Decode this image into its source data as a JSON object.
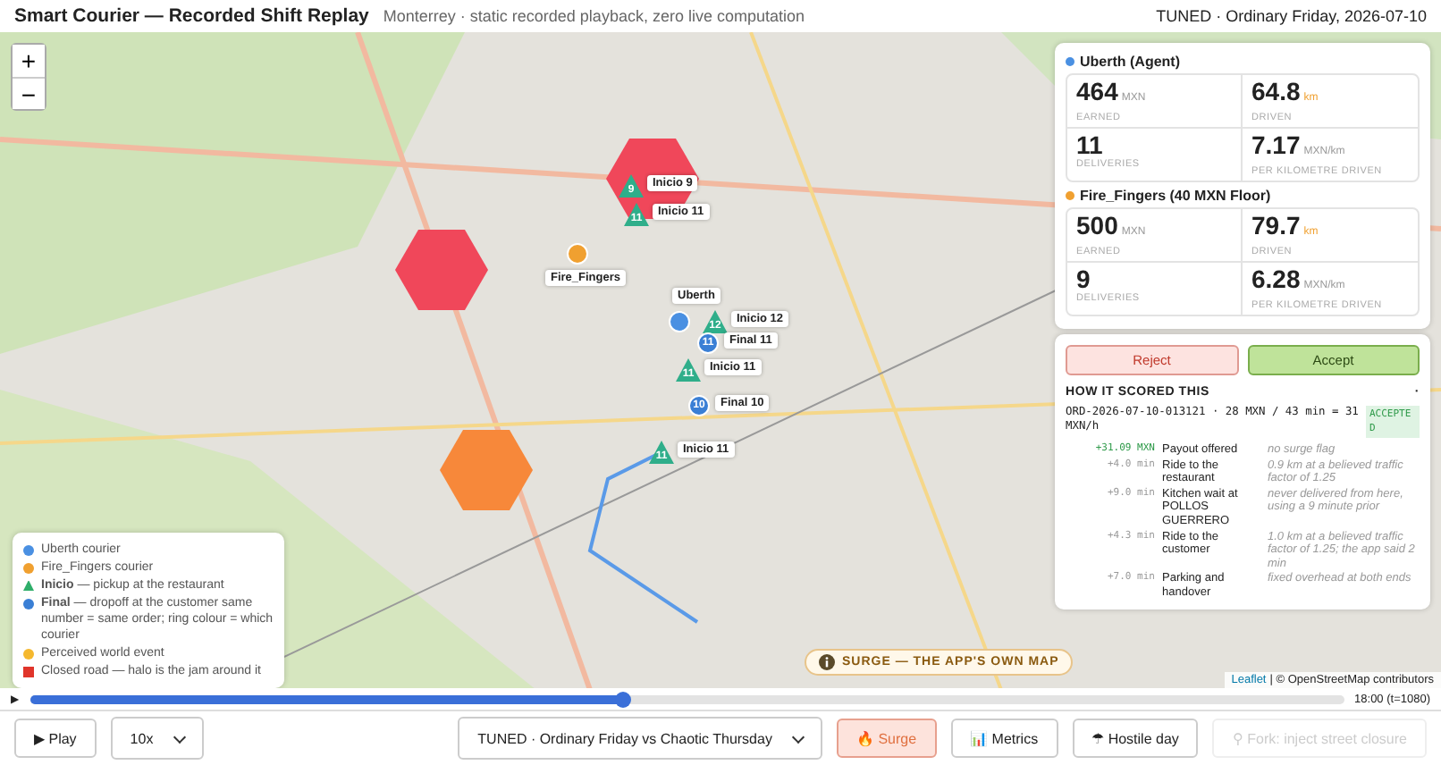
{
  "header": {
    "title": "Smart Courier — Recorded Shift Replay",
    "subtitle": "Monterrey · static recorded playback, zero live computation",
    "status": "TUNED · Ordinary Friday, 2026-07-10"
  },
  "map": {
    "zoom_controls": [
      "+",
      "−"
    ],
    "zones": [
      {
        "color": "#f0475a"
      },
      {
        "color": "#f0475a"
      },
      {
        "color": "#f7883a"
      }
    ],
    "markers": [
      {
        "kind": "pickup",
        "number": "9",
        "label": "Inicio 9"
      },
      {
        "kind": "pickup",
        "number": "11",
        "label": "Inicio 11"
      },
      {
        "kind": "courier",
        "label": "Fire_Fingers",
        "color": "#f0a030"
      },
      {
        "kind": "courier",
        "label": "Uberth",
        "color": "#4a90e2"
      },
      {
        "kind": "pickup",
        "number": "12",
        "label": "Inicio 12"
      },
      {
        "kind": "dropoff",
        "number": "11",
        "label": "Final 11"
      },
      {
        "kind": "pickup",
        "number": "11",
        "label": "Inicio 11"
      },
      {
        "kind": "dropoff",
        "number": "10",
        "label": "Final 10"
      },
      {
        "kind": "pickup",
        "number": "11",
        "label": "Inicio 11"
      }
    ],
    "legend": [
      {
        "kind": "dot",
        "color": "#4a90e2",
        "text": "Uberth courier"
      },
      {
        "kind": "dot",
        "color": "#f0a030",
        "text": "Fire_Fingers courier"
      },
      {
        "kind": "triangle",
        "color": "#2fae6a",
        "text": "**Inicio** — pickup at the restaurant"
      },
      {
        "kind": "dot",
        "color": "#3a7fd5",
        "text": "**Final** — dropoff at the customer same number = same order; ring colour = which courier"
      },
      {
        "kind": "dot",
        "color": "#f5b82e",
        "text": "Perceived world event"
      },
      {
        "kind": "square",
        "color": "#e0352b",
        "text": "Closed road — halo is the jam around it"
      }
    ],
    "map_badge": "SURGE — THE APP'S OWN MAP",
    "attribution": {
      "link": "Leaflet",
      "text": "| © OpenStreetMap contributors"
    }
  },
  "agents": [
    {
      "name": "Uberth (Agent)",
      "color": "#4a90e2",
      "stats": [
        {
          "value": "464",
          "unit": "MXN",
          "label": "EARNED",
          "accent": false
        },
        {
          "value": "64.8",
          "unit": "km",
          "label": "DRIVEN",
          "accent": true
        },
        {
          "value": "11",
          "label": "DELIVERIES"
        },
        {
          "value": "7.17",
          "unit": "MXN/km",
          "label": "PER KILOMETRE DRIVEN",
          "accent": false
        }
      ]
    },
    {
      "name": "Fire_Fingers (40 MXN Floor)",
      "color": "#f0a030",
      "stats": [
        {
          "value": "500",
          "unit": "MXN",
          "label": "EARNED",
          "accent": false
        },
        {
          "value": "79.7",
          "unit": "km",
          "label": "DRIVEN",
          "accent": true
        },
        {
          "value": "9",
          "label": "DELIVERIES"
        },
        {
          "value": "6.28",
          "unit": "MXN/km",
          "label": "PER KILOMETRE DRIVEN",
          "accent": false
        }
      ]
    }
  ],
  "decision": {
    "buttons": [
      {
        "kind": "reject",
        "label": "Reject"
      },
      {
        "kind": "accept",
        "label": "Accept"
      }
    ],
    "section_title": "HOW IT SCORED THIS",
    "toggle": "·",
    "order": "ORD-2026-07-10-013121 · 28 MXN / 43 min = 31 MXN/h",
    "verdict": "ACCEPTED",
    "rows": [
      {
        "kind": "money",
        "delta": "+31.09 MXN",
        "item": "Payout offered",
        "note": "no surge flag"
      },
      {
        "kind": "time",
        "delta": "+4.0 min",
        "item": "Ride to the restaurant",
        "note": "0.9 km at a believed traffic factor of 1.25"
      },
      {
        "kind": "time",
        "delta": "+9.0 min",
        "item": "Kitchen wait at POLLOS GUERRERO",
        "note": "never delivered from here, using a 9 minute prior"
      },
      {
        "kind": "time",
        "delta": "+4.3 min",
        "item": "Ride to the customer",
        "note": "1.0 km at a believed traffic factor of 1.25; the app said 2 min"
      },
      {
        "kind": "time",
        "delta": "+7.0 min",
        "item": "Parking and handover",
        "note": "fixed overhead at both ends"
      }
    ]
  },
  "timeline": {
    "play_icon": "▶",
    "level": 0.45,
    "time": "18:00 (t=1080)"
  },
  "controls": [
    {
      "kind": "button",
      "icon": "▶",
      "label": "Play",
      "selected": false,
      "disabled": false
    },
    {
      "kind": "select",
      "label": "10x"
    },
    {
      "kind": "select",
      "label": "TUNED · Ordinary Friday vs Chaotic Thursday"
    },
    {
      "kind": "button",
      "icon": "🔥",
      "label": "Surge",
      "selected": true,
      "disabled": false
    },
    {
      "kind": "button",
      "icon": "📊",
      "label": "Metrics",
      "selected": false,
      "disabled": false
    },
    {
      "kind": "button",
      "icon": "☂",
      "label": "Hostile day",
      "selected": false,
      "disabled": false
    },
    {
      "kind": "button",
      "icon": "⚲",
      "label": "Fork: inject street closure",
      "selected": false,
      "disabled": true
    }
  ]
}
